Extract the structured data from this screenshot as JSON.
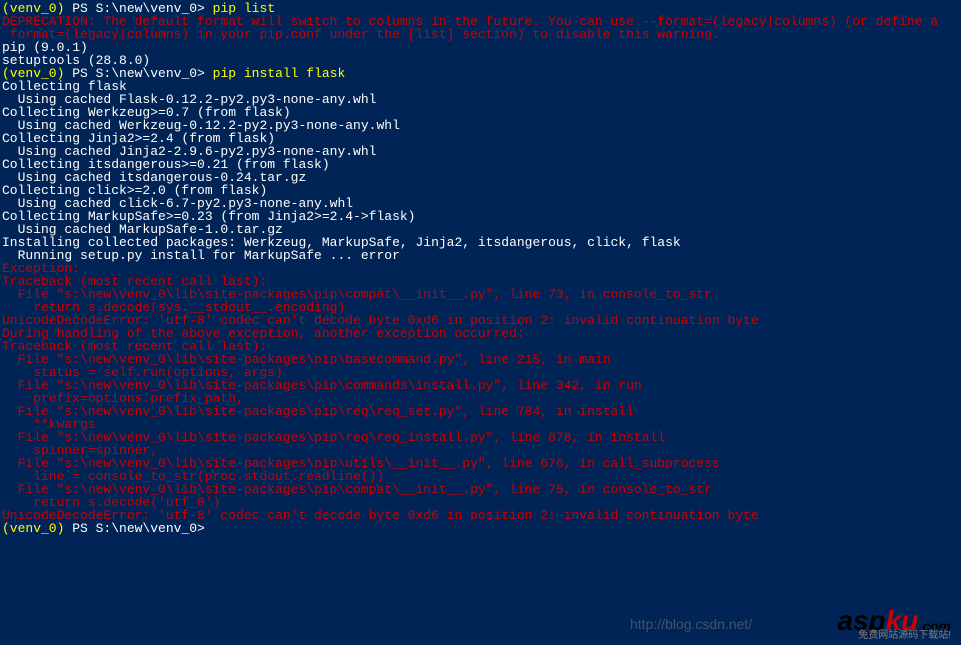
{
  "prompt1": {
    "venv": "(venv_0)",
    "path": " PS S:\\new\\venv_0> ",
    "cmd": "pip list"
  },
  "deprecation_line1": "DEPRECATION: The default format will switch to columns in the future. You can use --format=(legacy|columns) (or define a",
  "deprecation_line2": " format=(legacy|columns) in your pip.conf under the [list] section) to disable this warning.",
  "pip_version": "pip (9.0.1)",
  "setuptools_version": "setuptools (28.8.0)",
  "prompt2": {
    "venv": "(venv_0)",
    "path": " PS S:\\new\\venv_0> ",
    "cmd": "pip install flask"
  },
  "collecting": [
    "Collecting flask",
    "  Using cached Flask-0.12.2-py2.py3-none-any.whl",
    "Collecting Werkzeug>=0.7 (from flask)",
    "  Using cached Werkzeug-0.12.2-py2.py3-none-any.whl",
    "Collecting Jinja2>=2.4 (from flask)",
    "  Using cached Jinja2-2.9.6-py2.py3-none-any.whl",
    "Collecting itsdangerous>=0.21 (from flask)",
    "  Using cached itsdangerous-0.24.tar.gz",
    "Collecting click>=2.0 (from flask)",
    "  Using cached click-6.7-py2.py3-none-any.whl",
    "Collecting MarkupSafe>=0.23 (from Jinja2>=2.4->flask)",
    "  Using cached MarkupSafe-1.0.tar.gz",
    "Installing collected packages: Werkzeug, MarkupSafe, Jinja2, itsdangerous, click, flask",
    "  Running setup.py install for MarkupSafe ... error"
  ],
  "errors": [
    "Exception:",
    "Traceback (most recent call last):",
    "  File \"s:\\new\\venv_0\\lib\\site-packages\\pip\\compat\\__init__.py\", line 73, in console_to_str",
    "    return s.decode(sys.__stdout__.encoding)",
    "UnicodeDecodeError: 'utf-8' codec can't decode byte 0xd6 in position 2: invalid continuation byte",
    "",
    "During handling of the above exception, another exception occurred:",
    "",
    "Traceback (most recent call last):",
    "  File \"s:\\new\\venv_0\\lib\\site-packages\\pip\\basecommand.py\", line 215, in main",
    "    status = self.run(options, args)",
    "  File \"s:\\new\\venv_0\\lib\\site-packages\\pip\\commands\\install.py\", line 342, in run",
    "    prefix=options.prefix_path,",
    "  File \"s:\\new\\venv_0\\lib\\site-packages\\pip\\req\\req_set.py\", line 784, in install",
    "    **kwargs",
    "  File \"s:\\new\\venv_0\\lib\\site-packages\\pip\\req\\req_install.py\", line 878, in install",
    "    spinner=spinner,",
    "  File \"s:\\new\\venv_0\\lib\\site-packages\\pip\\utils\\__init__.py\", line 676, in call_subprocess",
    "    line = console_to_str(proc.stdout.readline())",
    "  File \"s:\\new\\venv_0\\lib\\site-packages\\pip\\compat\\__init__.py\", line 75, in console_to_str",
    "    return s.decode('utf_8')",
    "UnicodeDecodeError: 'utf-8' codec can't decode byte 0xd6 in position 2: invalid continuation byte"
  ],
  "prompt3": {
    "venv": "(venv_0)",
    "path": " PS S:\\new\\venv_0> "
  },
  "watermark_url": "http://blog.csdn.net/",
  "logo": {
    "prefix": "asp",
    "suffix": "ku",
    "dot": ".com",
    "subtext": "免费网站源码下载站!"
  }
}
